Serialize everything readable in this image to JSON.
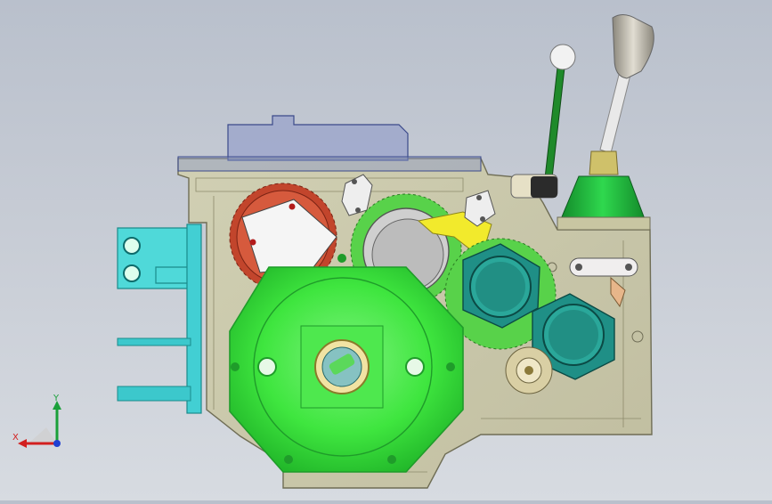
{
  "viewport": {
    "background_top": "#b9c0cc",
    "background_bottom": "#d7dbe1"
  },
  "colors": {
    "housing": "#c9c6a0",
    "housing_edge": "#6f6d55",
    "top_cover": "#8a96c8",
    "bracket": "#4fd9d9",
    "cover_plate": "#3fe63f",
    "cover_plate_dark": "#1f9c2a",
    "gear_red": "#c2452c",
    "gear_green": "#58d24a",
    "gear_teal": "#2aa79a",
    "bearing_teal": "#1f8f86",
    "yellow_bracket": "#f2ea2c",
    "lever_green": "#1f8a2a",
    "lever_knob_white": "#f2f2f2",
    "shift_rod": "#e9e9e9",
    "shift_knob": "#b8b3a6",
    "shift_boot": "#1fb83c",
    "triad_x": "#d21f1f",
    "triad_y": "#1aa03a",
    "triad_z": "#1f3fd2"
  },
  "triad": {
    "x_label": "X",
    "y_label": "Y"
  },
  "parts": [
    "gearbox-housing",
    "top-cover",
    "mounting-bracket",
    "front-cover-plate",
    "red-gear",
    "green-gear-upper",
    "green-gear-lower",
    "bearing-housing-left",
    "bearing-housing-right",
    "hand-lever",
    "shift-lever"
  ]
}
